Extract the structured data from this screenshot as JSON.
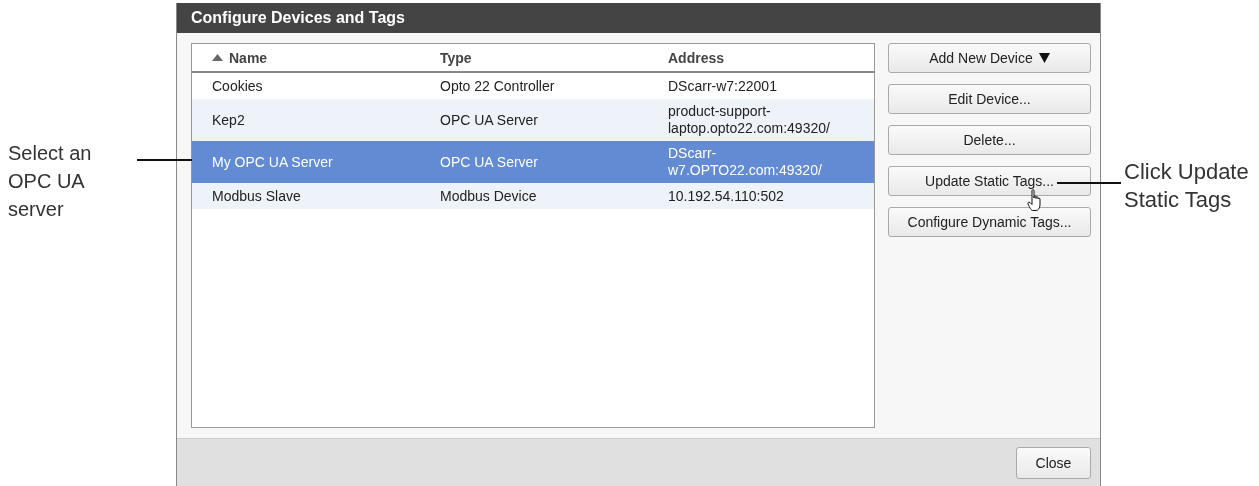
{
  "window": {
    "title": "Configure Devices and Tags"
  },
  "table": {
    "columns": [
      {
        "label": "Name",
        "sorted": true
      },
      {
        "label": "Type",
        "sorted": false
      },
      {
        "label": "Address",
        "sorted": false
      }
    ],
    "rows": [
      {
        "name": "Cookies",
        "type": "Opto 22 Controller",
        "address": "DScarr-w7:22001",
        "selected": false
      },
      {
        "name": "Kep2",
        "type": "OPC UA Server",
        "address": "product-support-laptop.opto22.com:49320/",
        "selected": false
      },
      {
        "name": "My OPC UA Server",
        "type": "OPC UA Server",
        "address": "DScarr-w7.OPTO22.com:49320/",
        "selected": true
      },
      {
        "name": "Modbus Slave",
        "type": "Modbus Device",
        "address": "10.192.54.110:502",
        "selected": false
      }
    ]
  },
  "buttons": [
    {
      "label": "Add New Device",
      "dropdown": true
    },
    {
      "label": "Edit Device...",
      "dropdown": false
    },
    {
      "label": "Delete...",
      "dropdown": false
    },
    {
      "label": "Update Static Tags...",
      "dropdown": false
    },
    {
      "label": "Configure Dynamic Tags...",
      "dropdown": false
    }
  ],
  "footer": {
    "close": "Close"
  },
  "callouts": [
    {
      "text": "Select an OPC UA server",
      "kind": "left"
    },
    {
      "text": "Click Update Static Tags",
      "kind": "right"
    }
  ]
}
